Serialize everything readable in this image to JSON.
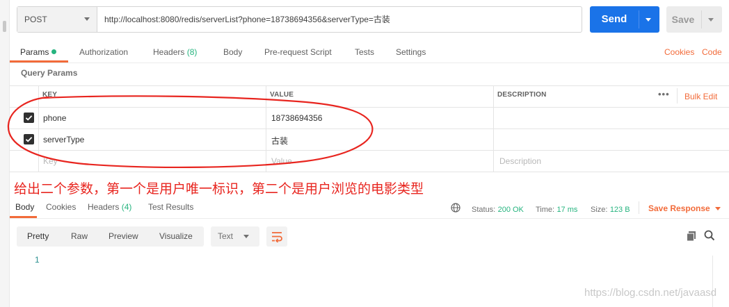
{
  "request": {
    "method": "POST",
    "url": "http://localhost:8080/redis/serverList?phone=18738694356&serverType=古装",
    "send_label": "Send",
    "save_label": "Save"
  },
  "tabs": {
    "params": "Params",
    "authorization": "Authorization",
    "headers": "Headers",
    "headers_count": "(8)",
    "body": "Body",
    "prerequest": "Pre-request Script",
    "tests": "Tests",
    "settings": "Settings",
    "cookies": "Cookies",
    "code": "Code"
  },
  "query_params": {
    "title": "Query Params",
    "columns": {
      "key": "KEY",
      "value": "VALUE",
      "description": "DESCRIPTION"
    },
    "bulk_edit": "Bulk Edit",
    "more": "•••",
    "rows": [
      {
        "key": "phone",
        "value": "18738694356",
        "description": "",
        "checked": true
      },
      {
        "key": "serverType",
        "value": "古装",
        "description": "",
        "checked": true
      }
    ],
    "placeholder": {
      "key": "Key",
      "value": "Value",
      "description": "Description"
    }
  },
  "annotation": "给出二个参数，第一个是用户唯一标识，第二个是用户浏览的电影类型",
  "response": {
    "tabs": {
      "body": "Body",
      "cookies": "Cookies",
      "headers": "Headers",
      "headers_count": "(4)",
      "test_results": "Test Results"
    },
    "status_label": "Status:",
    "status_value": "200 OK",
    "time_label": "Time:",
    "time_value": "17 ms",
    "size_label": "Size:",
    "size_value": "123 B",
    "save_response": "Save Response",
    "views": [
      "Pretty",
      "Raw",
      "Preview",
      "Visualize"
    ],
    "format": "Text",
    "line_number": "1"
  },
  "watermark": "https://blog.csdn.net/javaasd",
  "colors": {
    "send": "#1a73e8",
    "accent_orange": "#f26b3a",
    "accent_green": "#26b47f",
    "annotation_red": "#e8251f"
  },
  "icons": [
    "caret-down-icon",
    "checkbox-checked-icon",
    "globe-icon",
    "wrap-lines-icon",
    "copy-icon",
    "search-icon"
  ]
}
